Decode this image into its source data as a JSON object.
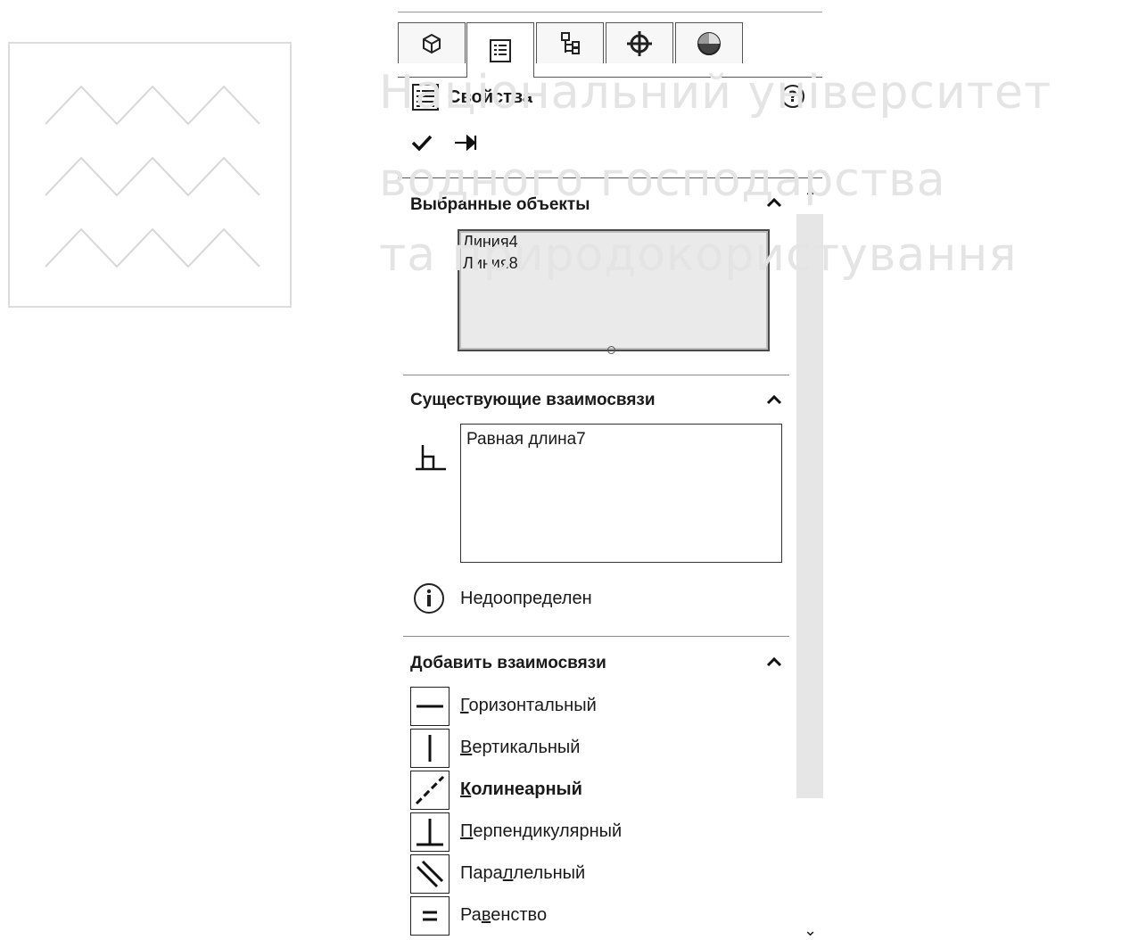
{
  "tabs": [
    {
      "icon": "feature-manager-icon",
      "active": false
    },
    {
      "icon": "property-manager-icon",
      "active": true
    },
    {
      "icon": "configuration-manager-icon",
      "active": false
    },
    {
      "icon": "dimxpert-manager-icon",
      "active": false
    },
    {
      "icon": "display-manager-icon",
      "active": false
    }
  ],
  "header": {
    "title": "Свойства",
    "help_icon": "help-icon"
  },
  "actions": {
    "ok_icon": "checkmark-icon",
    "pin_icon": "pushpin-icon"
  },
  "selected_entities": {
    "title": "Выбранные объекты",
    "items": [
      "Линия4",
      "Линия8"
    ]
  },
  "existing_relations": {
    "title": "Существующие взаимосвязи",
    "items": [
      "Равная длина7"
    ],
    "status": "Недоопределен",
    "status_icon": "info-icon"
  },
  "add_relations": {
    "title": "Добавить взаимосвязи",
    "items": [
      {
        "pre": "",
        "key": "Г",
        "post": "оризонтальный",
        "icon": "horizontal-relation-icon"
      },
      {
        "pre": "",
        "key": "В",
        "post": "ертикальный",
        "icon": "vertical-relation-icon"
      },
      {
        "pre": "",
        "key": "К",
        "post": "олинеарный",
        "icon": "collinear-relation-icon"
      },
      {
        "pre": "",
        "key": "П",
        "post": "ерпендикулярный",
        "icon": "perpendicular-relation-icon"
      },
      {
        "pre": "Пара",
        "key": "л",
        "post": "лельный",
        "icon": "parallel-relation-icon"
      },
      {
        "pre": "Ра",
        "key": "в",
        "post": "енство",
        "icon": "equal-relation-icon"
      }
    ]
  },
  "watermark": {
    "line1": "Національний університет",
    "line2": "водного господарства",
    "line3": "та природокористування"
  }
}
